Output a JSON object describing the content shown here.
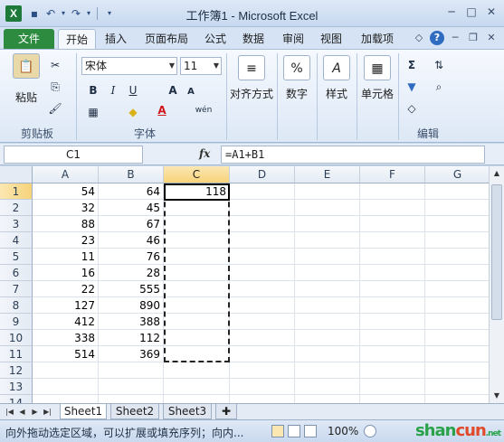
{
  "window": {
    "title": "工作簿1 - Microsoft Excel"
  },
  "tabs": [
    "文件",
    "开始",
    "插入",
    "页面布局",
    "公式",
    "数据",
    "审阅",
    "视图",
    "加载项"
  ],
  "ribbon": {
    "paste_label": "粘贴",
    "clipboard_label": "剪贴板",
    "font_name": "宋体",
    "font_size": "11",
    "bold": "B",
    "italic": "I",
    "underline": "U",
    "grow_font": "A",
    "shrink_font": "A",
    "wen": "wén",
    "font_label": "字体",
    "align_label": "对齐方式",
    "number_label": "数字",
    "number_icon": "%",
    "style_label": "样式",
    "cell_label": "单元格",
    "edit_label": "编辑"
  },
  "formula_bar": {
    "name_box": "C1",
    "fx": "fx",
    "formula": "=A1+B1"
  },
  "columns": [
    "A",
    "B",
    "C",
    "D",
    "E",
    "F",
    "G"
  ],
  "selected_column": "C",
  "rows": [
    "1",
    "2",
    "3",
    "4",
    "5",
    "6",
    "7",
    "8",
    "9",
    "10",
    "11",
    "12",
    "13",
    "14"
  ],
  "selected_row": "1",
  "cells": [
    {
      "a": "54",
      "b": "64",
      "c": "118"
    },
    {
      "a": "32",
      "b": "45",
      "c": ""
    },
    {
      "a": "88",
      "b": "67",
      "c": ""
    },
    {
      "a": "23",
      "b": "46",
      "c": ""
    },
    {
      "a": "11",
      "b": "76",
      "c": ""
    },
    {
      "a": "16",
      "b": "28",
      "c": ""
    },
    {
      "a": "22",
      "b": "555",
      "c": ""
    },
    {
      "a": "127",
      "b": "890",
      "c": ""
    },
    {
      "a": "412",
      "b": "388",
      "c": ""
    },
    {
      "a": "338",
      "b": "112",
      "c": ""
    },
    {
      "a": "514",
      "b": "369",
      "c": ""
    }
  ],
  "sheets": [
    "Sheet1",
    "Sheet2",
    "Sheet3"
  ],
  "active_sheet": "Sheet1",
  "status": {
    "message": "向外拖动选定区域，可以扩展或填充序列；向内...",
    "zoom": "100%"
  },
  "watermark": {
    "part1": "shan",
    "part2": "cun",
    "suffix": ".net"
  },
  "colors": {
    "file_tab": "#2c8b3f",
    "selected_header": "#f7d37a"
  }
}
